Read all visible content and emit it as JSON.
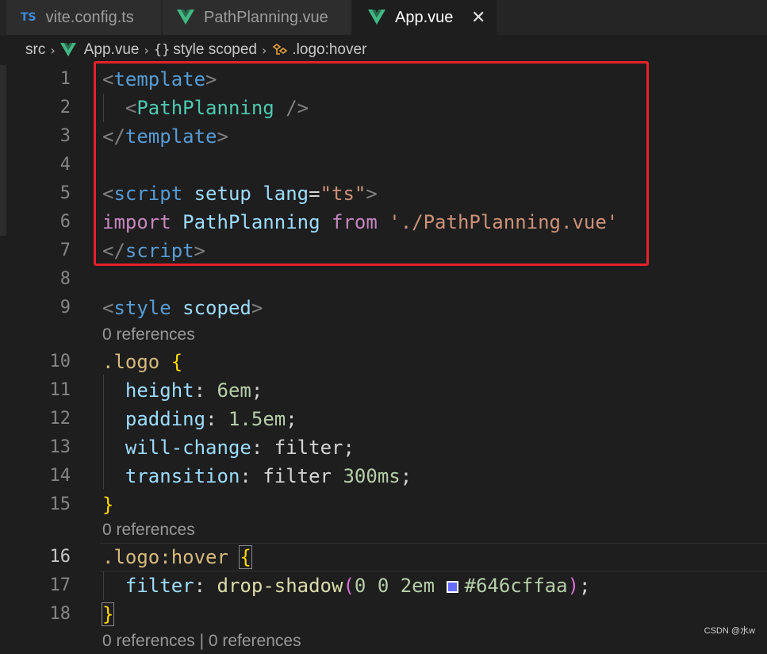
{
  "tabs": [
    {
      "label": "vite.config.ts",
      "icon": "TS"
    },
    {
      "label": "PathPlanning.vue",
      "icon": "vue-icon"
    },
    {
      "label": "App.vue",
      "icon": "vue-icon",
      "active": true,
      "close": "✕"
    }
  ],
  "breadcrumb": {
    "items": [
      "src",
      "App.vue",
      "style scoped",
      ".logo:hover"
    ],
    "separator": "›",
    "brace_icon": "{}"
  },
  "editor": {
    "line_numbers": [
      "1",
      "2",
      "3",
      "4",
      "5",
      "6",
      "7",
      "8",
      "9",
      "10",
      "11",
      "12",
      "13",
      "14",
      "15",
      "16",
      "17",
      "18"
    ],
    "codelens": [
      "0 references",
      "0 references",
      "0 references | 0 references"
    ],
    "tokens": {
      "lt": "<",
      "gt": ">",
      "lt_slash": "</",
      "self_close": " />",
      "eq": "=",
      "template": "template",
      "script": "script",
      "style": "style",
      "path_planning": "PathPlanning",
      "setup": "setup",
      "lang": "lang",
      "ts_value": "\"ts\"",
      "import": "import",
      "from": "from",
      "import_path": "'./PathPlanning.vue'",
      "scoped": "scoped",
      "logo_selector": ".logo",
      "logo_hover_selector": ".logo:hover",
      "brace_open": "{",
      "brace_close": "}",
      "prop_height": "height",
      "val_height": "6em",
      "prop_padding": "padding",
      "val_padding": "1.5em",
      "prop_will_change": "will-change",
      "val_will_change": "filter",
      "prop_transition": "transition",
      "val_transition_name": "filter",
      "val_transition_time": "300ms",
      "prop_filter": "filter",
      "fn_drop_shadow": "drop-shadow",
      "paren_open": "(",
      "paren_close": ")",
      "shadow_nums": "0 0 2em",
      "shadow_color": "#646cffaa",
      "colon": ":",
      "semicolon": ";"
    },
    "swatch_color": "#646cff"
  },
  "colors": {
    "background": "#1e1e1e",
    "highlight_box": "#e8212b",
    "tag": "#569cd6",
    "component": "#4ec9b0",
    "string": "#ce9178",
    "keyword": "#c586c0",
    "property": "#9cdcfe",
    "number": "#b5cea8",
    "selector": "#d7ba7d"
  },
  "watermark": "CSDN @水w"
}
